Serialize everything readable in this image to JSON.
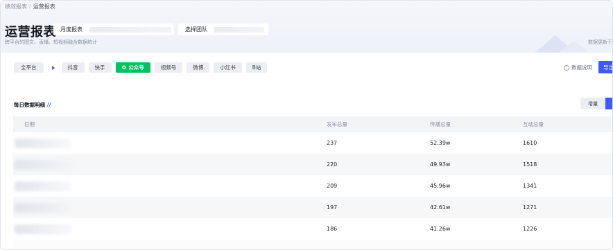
{
  "breadcrumb": {
    "parent": "绩效报表",
    "separator": "/",
    "current": "运营报表"
  },
  "page": {
    "title": "运营报表",
    "subtitle": "跨平台的图文、直播、短视频融合数据统计",
    "update_note": "数据更新于"
  },
  "filters": {
    "period_label": "月度报表",
    "team_label": "选择团队"
  },
  "platforms": {
    "items": [
      {
        "label": "全平台",
        "active": false
      },
      {
        "label": "抖音",
        "active": false
      },
      {
        "label": "快手",
        "active": false
      },
      {
        "label": "公众号",
        "active": true,
        "icon": "wechat-icon"
      },
      {
        "label": "视频号",
        "active": false
      },
      {
        "label": "微博",
        "active": false
      },
      {
        "label": "小红书",
        "active": false
      },
      {
        "label": "B站",
        "active": false
      }
    ],
    "active_color": "#07c160"
  },
  "toolbar": {
    "explain_label": "数据说明",
    "export_label": "导出"
  },
  "section": {
    "title": "每日数据明细",
    "decoration": "//",
    "increment_label": "增量"
  },
  "table": {
    "headers": [
      "日期",
      "发布总量",
      "传播总量",
      "互动总量"
    ],
    "rows": [
      {
        "date": "",
        "publish": "237",
        "spread": "52.39w",
        "interact": "1610"
      },
      {
        "date": "",
        "publish": "220",
        "spread": "49.93w",
        "interact": "1518"
      },
      {
        "date": "",
        "publish": "209",
        "spread": "45.96w",
        "interact": "1341"
      },
      {
        "date": "",
        "publish": "197",
        "spread": "42.61w",
        "interact": "1271"
      },
      {
        "date": "",
        "publish": "186",
        "spread": "41.26w",
        "interact": "1226"
      }
    ]
  },
  "colors": {
    "accent": "#3d5afe",
    "wechat_green": "#07c160"
  }
}
